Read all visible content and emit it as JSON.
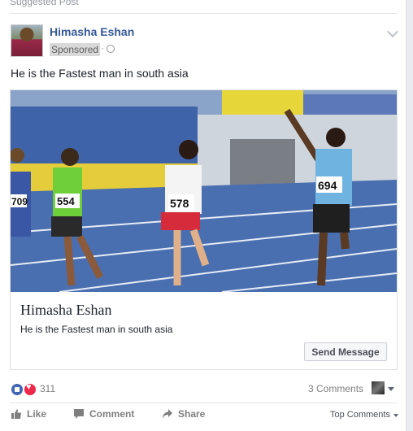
{
  "post": {
    "suggested_label": "Suggested Post",
    "author": "Himasha Eshan",
    "sponsored_label": "Sponsored",
    "text": "He is the Fastest man in south asia"
  },
  "link_card": {
    "image_alt": "Sprinters racing on a track",
    "bib_numbers": [
      "709",
      "554",
      "578",
      "694"
    ],
    "title": "Himasha Eshan",
    "description": "He is the Fastest man in south asia",
    "cta_label": "Send Message"
  },
  "reactions": {
    "count": "311",
    "comments_label": "3 Comments"
  },
  "actions": {
    "like": "Like",
    "comment": "Comment",
    "share": "Share",
    "top_comments": "Top Comments"
  },
  "colors": {
    "link_blue": "#365899",
    "like_blue": "#4267b2",
    "love_red": "#f0284a",
    "track_blue": "#4a6fb0"
  }
}
